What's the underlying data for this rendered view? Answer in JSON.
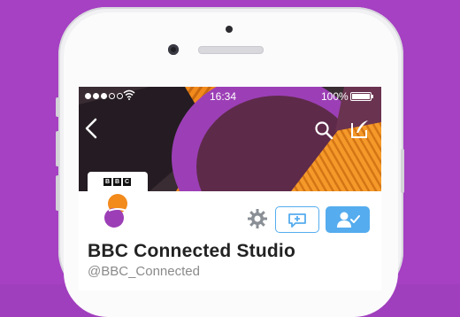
{
  "status_bar": {
    "time": "16:34",
    "battery_text": "100%",
    "signal_dots": 5,
    "signal_filled": 3
  },
  "nav": {
    "back_icon": "chevron-left-icon",
    "search_icon": "search-icon",
    "compose_icon": "compose-icon"
  },
  "profile": {
    "logo_letters": [
      "B",
      "B",
      "C"
    ],
    "name": "BBC Connected Studio",
    "handle": "@BBC_Connected"
  },
  "actions": {
    "settings_icon": "gear-icon",
    "message_icon": "direct-message-icon",
    "following_icon": "following-user-icon"
  },
  "colors": {
    "background": "#a541c2",
    "accent": "#55acee",
    "banner_orange": "#f28a1c",
    "banner_purple": "#9c3fb6"
  }
}
